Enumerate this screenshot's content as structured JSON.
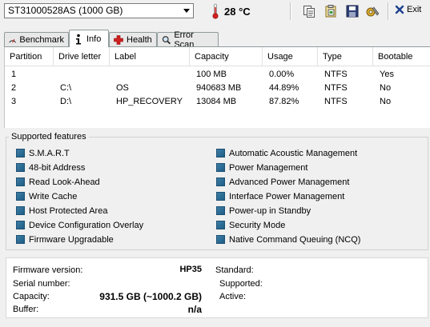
{
  "toolbar": {
    "drive_selected": "ST31000528AS (1000 GB)",
    "temperature": "28 °C",
    "exit_label": "Exit",
    "buttons": [
      "copy-text-icon",
      "copy-all-icon",
      "save-icon",
      "options-icon"
    ]
  },
  "tabs": [
    {
      "label": "Benchmark",
      "icon": "benchmark-icon"
    },
    {
      "label": "Info",
      "icon": "info-icon",
      "active": true
    },
    {
      "label": "Health",
      "icon": "health-cross-icon"
    },
    {
      "label": "Error Scan",
      "icon": "magnifier-icon"
    }
  ],
  "partitions": {
    "headers": [
      "Partition",
      "Drive letter",
      "Label",
      "Capacity",
      "Usage",
      "Type",
      "Bootable"
    ],
    "rows": [
      [
        "1",
        "",
        "",
        "100 MB",
        "0.00%",
        "NTFS",
        "Yes"
      ],
      [
        "2",
        "C:\\",
        "OS",
        "940683 MB",
        "44.89%",
        "NTFS",
        "No"
      ],
      [
        "3",
        "D:\\",
        "HP_RECOVERY",
        "13084 MB",
        "87.82%",
        "NTFS",
        "No"
      ]
    ]
  },
  "features": {
    "title": "Supported features",
    "left": [
      "S.M.A.R.T",
      "48-bit Address",
      "Read Look-Ahead",
      "Write Cache",
      "Host Protected Area",
      "Device Configuration Overlay",
      "Firmware Upgradable"
    ],
    "right": [
      "Automatic Acoustic Management",
      "Power Management",
      "Advanced Power Management",
      "Interface Power Management",
      "Power-up in Standby",
      "Security Mode",
      "Native Command Queuing (NCQ)"
    ]
  },
  "info": {
    "firmware_label": "Firmware version:",
    "firmware_value": "HP35",
    "serial_label": "Serial number:",
    "serial_value": "",
    "capacity_label": "Capacity:",
    "capacity_value": "931.5 GB (~1000.2 GB)",
    "buffer_label": "Buffer:",
    "buffer_value": "n/a",
    "standard_label": "Standard:",
    "supported_label": "Supported:",
    "active_label": "Active:"
  },
  "colors": {
    "feature_check": "#2a6a93",
    "tab_border": "#919b9c",
    "temp_red": "#d02020"
  }
}
